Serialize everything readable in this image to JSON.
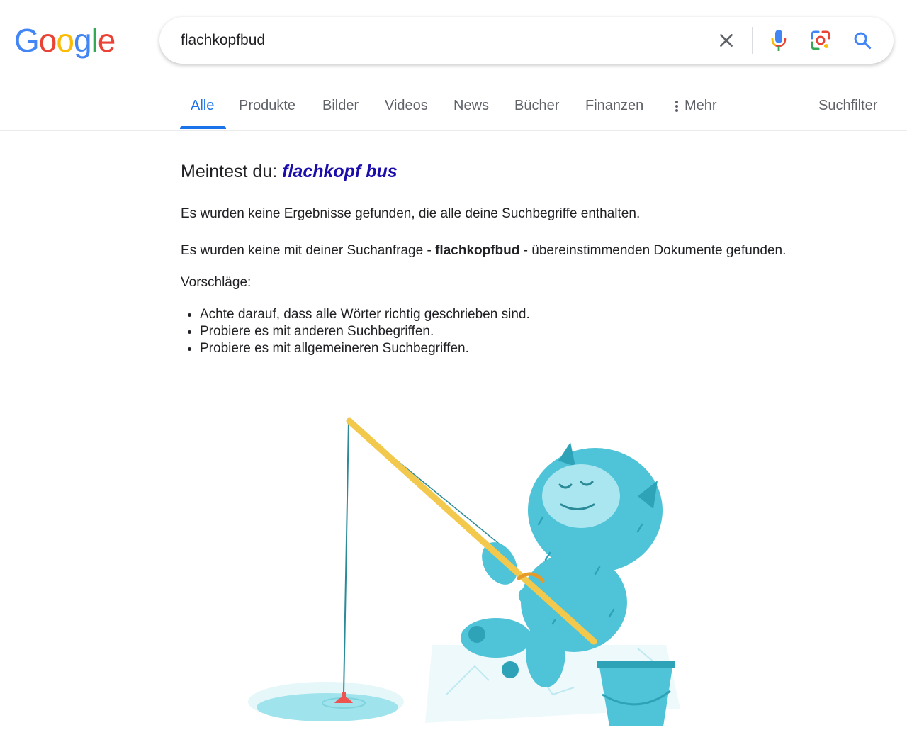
{
  "logo": {
    "letters": [
      "G",
      "o",
      "o",
      "g",
      "l",
      "e"
    ],
    "colors": [
      "#4285F4",
      "#EA4335",
      "#FBBC05",
      "#4285F4",
      "#34A853",
      "#EA4335"
    ]
  },
  "search": {
    "query": "flachkopfbud",
    "clear_icon": "close-icon",
    "voice_icon": "microphone-icon",
    "lens_icon": "camera-lens-icon",
    "search_icon": "search-icon"
  },
  "tabs": {
    "items": [
      {
        "label": "Alle",
        "active": true
      },
      {
        "label": "Produkte",
        "active": false
      },
      {
        "label": "Bilder",
        "active": false
      },
      {
        "label": "Videos",
        "active": false
      },
      {
        "label": "News",
        "active": false
      },
      {
        "label": "Bücher",
        "active": false
      },
      {
        "label": "Finanzen",
        "active": false
      }
    ],
    "more_label": "Mehr",
    "tools_label": "Suchfilter",
    "accent": "#1a73e8"
  },
  "results": {
    "did_you_mean_prefix": "Meintest du:",
    "did_you_mean_suggestion": "flachkopf bus",
    "no_results_all_terms": "Es wurden keine Ergebnisse gefunden, die alle deine Suchbegriffe enthalten.",
    "no_docs_prefix": "Es wurden keine mit deiner Suchanfrage - ",
    "no_docs_query": "flachkopfbud",
    "no_docs_suffix": " - übereinstimmenden Dokumente gefunden.",
    "suggestions_heading": "Vorschläge:",
    "suggestions": [
      "Achte darauf, dass alle Wörter richtig geschrieben sind.",
      "Probiere es mit anderen Suchbegriffen.",
      "Probiere es mit allgemeineren Suchbegriffen."
    ]
  },
  "illustration": {
    "name": "fishing-monster-illustration",
    "colors": {
      "body": "#4fc3d7",
      "body_dark": "#2ea3b8",
      "face": "#a9e6ef",
      "rod": "#f2c94c",
      "bobber": "#ef5350",
      "ice": "#e6f7fa",
      "water": "#9fe3ec"
    }
  }
}
